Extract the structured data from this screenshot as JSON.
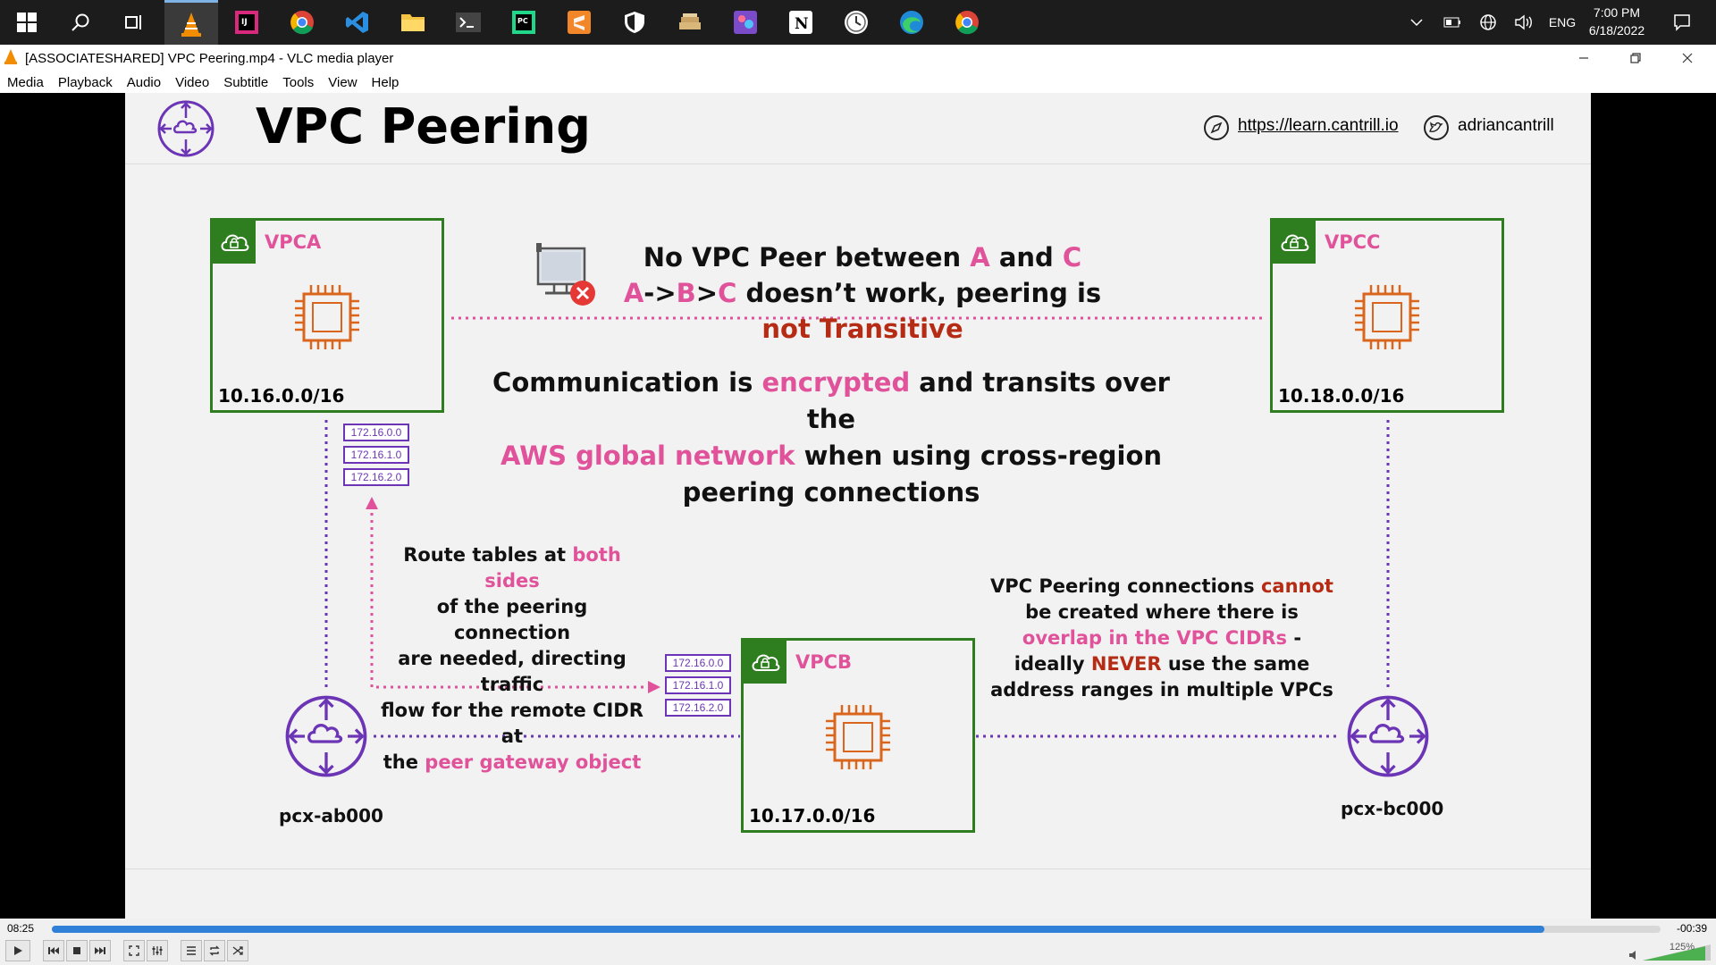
{
  "taskbar": {
    "tray_lang": "ENG",
    "clock_time": "7:00 PM",
    "clock_date": "6/18/2022",
    "icons": [
      "windows-start-icon",
      "search-icon",
      "task-view-icon",
      "vlc-icon",
      "intellij-icon",
      "chrome-icon",
      "vscode-icon",
      "file-explorer-icon",
      "terminal-icon",
      "pycharm-icon",
      "sublime-icon",
      "shield-icon",
      "books-icon",
      "photo-app-icon",
      "notion-icon",
      "clock-app-icon",
      "edge-icon",
      "chrome-alt-icon"
    ]
  },
  "window": {
    "title": "[ASSOCIATESHARED] VPC Peering.mp4 - VLC media player"
  },
  "menu": [
    "Media",
    "Playback",
    "Audio",
    "Video",
    "Subtitle",
    "Tools",
    "View",
    "Help"
  ],
  "slide": {
    "title": "VPC Peering",
    "link_url": "https://learn.cantrill.io",
    "twitter": "adriancantrill",
    "vpc_a": {
      "name": "VPCA",
      "cidr": "10.16.0.0/16"
    },
    "vpc_b": {
      "name": "VPCB",
      "cidr": "10.17.0.0/16"
    },
    "vpc_c": {
      "name": "VPCC",
      "cidr": "10.18.0.0/16"
    },
    "route_table_a": [
      "172.16.0.0",
      "172.16.1.0",
      "172.16.2.0"
    ],
    "route_table_b": [
      "172.16.0.0",
      "172.16.1.0",
      "172.16.2.0"
    ],
    "pcx_ab": "pcx-ab000",
    "pcx_bc": "pcx-bc000",
    "no_peer": {
      "l1_a": "No VPC Peer between ",
      "l1_b": "A",
      "l1_c": " and ",
      "l1_d": "C",
      "l2_a": "A",
      "l2_b": "->",
      "l2_c": "B",
      "l2_d": ">",
      "l2_e": "C",
      "l2_f": " doesn’t work, peering is ",
      "l2_g": "not Transitive"
    },
    "encryption": {
      "l1_a": "Communication is ",
      "l1_b": "encrypted",
      "l1_c": " and transits over the",
      "l2_a": "AWS global network",
      "l2_b": " when using cross-region",
      "l3": "peering connections"
    },
    "route_note": {
      "l1_a": "Route tables at ",
      "l1_b": "both sides",
      "l2": "of the peering connection",
      "l3": "are needed, directing traffic",
      "l4": "flow for the remote CIDR at",
      "l5_a": "the ",
      "l5_b": "peer gateway object"
    },
    "overlap_note": {
      "l1_a": "VPC Peering connections ",
      "l1_b": "cannot",
      "l2": "be created where there is",
      "l3_a": "overlap in the VPC CIDRs",
      "l3_b": " -",
      "l4_a": "ideally ",
      "l4_b": "NEVER",
      "l4_c": " use the same",
      "l5": "address ranges in multiple VPCs"
    }
  },
  "player": {
    "elapsed": "08:25",
    "remaining": "-00:39",
    "progress": 0.928,
    "volume": "125%"
  },
  "colors": {
    "vpc_green": "#2e7d1f",
    "accent_pink": "#e0529a",
    "accent_red": "#b52b14",
    "peering_purple": "#6b35b5",
    "chip_orange": "#d9661c"
  }
}
